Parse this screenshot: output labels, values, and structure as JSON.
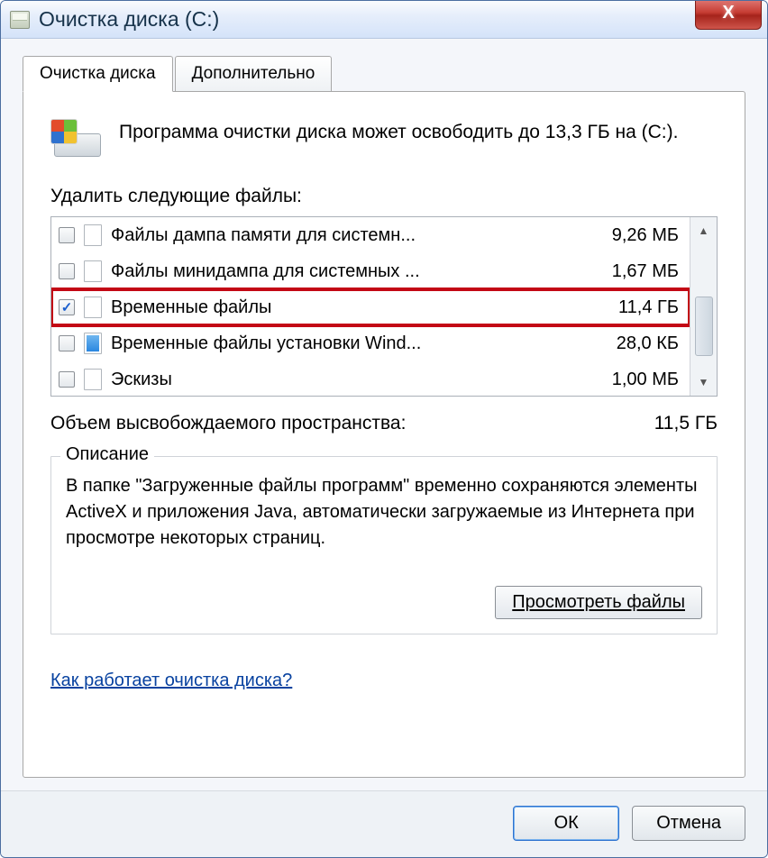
{
  "window": {
    "title": "Очистка диска  (C:)"
  },
  "tabs": {
    "cleanup": "Очистка диска",
    "more": "Дополнительно"
  },
  "intro": "Программа очистки диска может освободить до 13,3 ГБ на  (C:).",
  "list_label": "Удалить следующие файлы:",
  "files": [
    {
      "name": "Файлы дампа памяти для системн...",
      "size": "9,26 МБ",
      "checked": false,
      "icon": "file"
    },
    {
      "name": "Файлы минидампа для системных ...",
      "size": "1,67 МБ",
      "checked": false,
      "icon": "file"
    },
    {
      "name": "Временные файлы",
      "size": "11,4 ГБ",
      "checked": true,
      "icon": "file",
      "highlighted": true
    },
    {
      "name": "Временные файлы установки Wind...",
      "size": "28,0 КБ",
      "checked": false,
      "icon": "win"
    },
    {
      "name": "Эскизы",
      "size": "1,00 МБ",
      "checked": false,
      "icon": "file"
    }
  ],
  "freed": {
    "label": "Объем высвобождаемого пространства:",
    "value": "11,5 ГБ"
  },
  "description": {
    "legend": "Описание",
    "text": "В папке \"Загруженные файлы программ\" временно сохраняются элементы ActiveX и приложения Java, автоматически загружаемые из Интернета при просмотре некоторых страниц.",
    "view_button": "Просмотреть файлы"
  },
  "help_link": "Как работает очистка диска?",
  "buttons": {
    "ok": "ОК",
    "cancel": "Отмена"
  },
  "close_glyph": "X"
}
